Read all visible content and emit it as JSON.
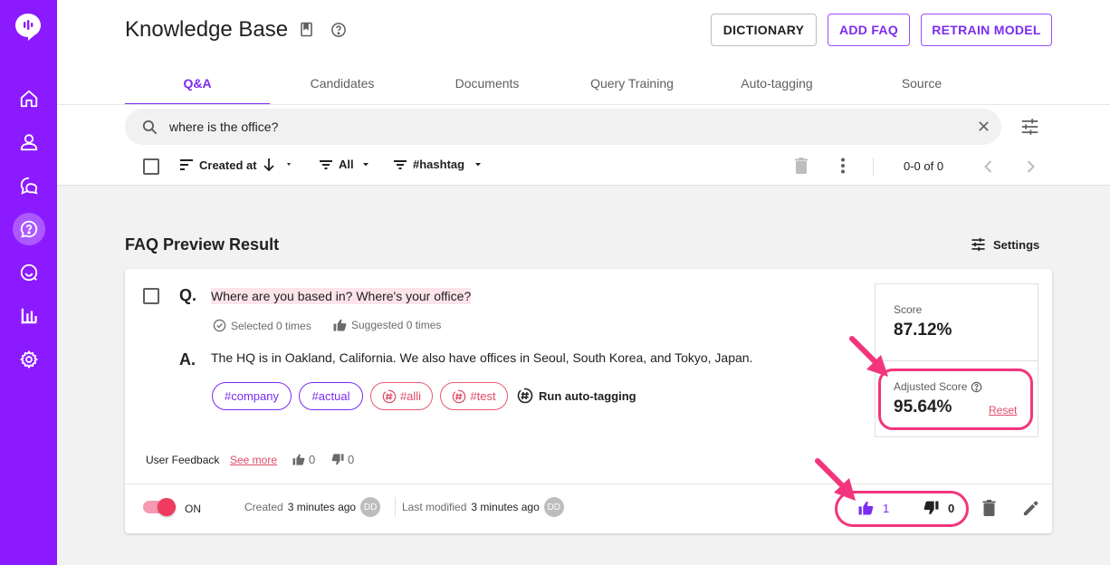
{
  "app": {
    "title": "Knowledge Base",
    "accent_color": "#8c1aff",
    "highlight_color": "#f2357c"
  },
  "sidebar": {
    "items": [
      {
        "icon": "home-icon"
      },
      {
        "icon": "user-icon"
      },
      {
        "icon": "chat-icon"
      },
      {
        "icon": "faq-icon",
        "active": true
      },
      {
        "icon": "search-chat-icon"
      },
      {
        "icon": "analytics-icon"
      },
      {
        "icon": "gear-icon"
      }
    ]
  },
  "header": {
    "buttons": {
      "dictionary": "DICTIONARY",
      "add_faq": "ADD FAQ",
      "retrain": "RETRAIN MODEL"
    }
  },
  "tabs": [
    "Q&A",
    "Candidates",
    "Documents",
    "Query Training",
    "Auto-tagging",
    "Source"
  ],
  "search": {
    "value": "where is the office?"
  },
  "toolbar": {
    "sort": "Created at",
    "filter": "All",
    "hashtag": "#hashtag",
    "pagination": "0-0 of 0"
  },
  "section": {
    "title": "FAQ Preview Result",
    "settings": "Settings"
  },
  "faq": {
    "q_label": "Q.",
    "question": "Where are you based in? Where's your office?",
    "selected": "Selected 0 times",
    "suggested": "Suggested 0 times",
    "a_label": "A.",
    "answer": "The HQ is in Oakland, California. We also have offices in Seoul, South Korea, and Tokyo, Japan.",
    "tags": [
      {
        "label": "#company",
        "style": "primary"
      },
      {
        "label": "#actual",
        "style": "primary"
      },
      {
        "label": "#alli",
        "style": "auto"
      },
      {
        "label": "#test",
        "style": "auto"
      }
    ],
    "auto_tagging": "Run auto-tagging",
    "user_feedback": "User Feedback",
    "see_more": "See more",
    "feedback_up": "0",
    "feedback_down": "0",
    "score_label": "Score",
    "score_value": "87.12%",
    "adjusted_label": "Adjusted Score",
    "adjusted_value": "95.64%",
    "reset": "Reset",
    "toggle_label": "ON",
    "created_prefix": "Created",
    "created_time": "3 minutes ago",
    "modified_prefix": "Last modified",
    "modified_time": "3 minutes ago",
    "avatar": "DD",
    "votes_up": "1",
    "votes_down": "0"
  }
}
